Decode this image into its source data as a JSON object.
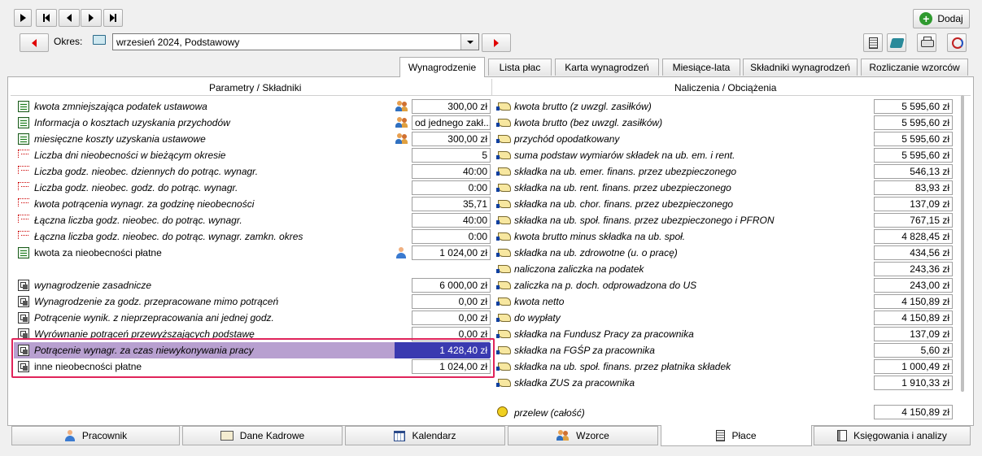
{
  "nav": {
    "period_label": "Okres:",
    "period_value": "wrzesień 2024, Podstawowy"
  },
  "toolbar": {
    "add_label": "Dodaj"
  },
  "tabs": [
    {
      "label": "Wynagrodzenie",
      "active": true
    },
    {
      "label": "Lista płac",
      "active": false
    },
    {
      "label": "Karta wynagrodzeń",
      "active": false
    },
    {
      "label": "Miesiące-lata",
      "active": false
    },
    {
      "label": "Składniki wynagrodzeń",
      "active": false
    },
    {
      "label": "Rozliczanie wzorców",
      "active": false
    }
  ],
  "left": {
    "header": "Parametry / Składniki",
    "rows": [
      {
        "label": "kwota zmniejszająca podatek ustawowa",
        "value": "300,00 zł",
        "icon": "doc-icon",
        "extra": "people-icon"
      },
      {
        "label": "Informacja o kosztach uzyskania przychodów",
        "value": "od jednego zakł...",
        "icon": "doc-icon",
        "extra": "people-icon"
      },
      {
        "label": "miesięczne koszty uzyskania ustawowe",
        "value": "300,00 zł",
        "icon": "doc-icon",
        "extra": "people-icon"
      },
      {
        "label": "Liczba dni nieobecności w bieżącym okresie",
        "value": "5",
        "icon": "dots-icon"
      },
      {
        "label": "Liczba godz. nieobec. dziennych do potrąc. wynagr.",
        "value": "40:00",
        "icon": "dots-icon"
      },
      {
        "label": "Liczba godz. nieobec. godz. do potrąc. wynagr.",
        "value": "0:00",
        "icon": "dots-icon"
      },
      {
        "label": "kwota potrącenia wynagr. za godzinę nieobecności",
        "value": "35,71",
        "icon": "dots-icon"
      },
      {
        "label": "Łączna liczba godz. nieobec. do potrąc. wynagr.",
        "value": "40:00",
        "icon": "dots-icon"
      },
      {
        "label": "Łączna liczba godz. nieobec. do potrąc. wynagr. zamkn. okres",
        "value": "0:00",
        "icon": "dots-icon"
      },
      {
        "label": "kwota za nieobecności płatne",
        "value": "1 024,00 zł",
        "icon": "doc-icon",
        "extra": "person-icon",
        "normal": true
      },
      {
        "label": "wynagrodzenie zasadnicze",
        "value": "6 000,00 zł",
        "icon": "calc-icon"
      },
      {
        "label": "Wynagrodzenie za godz. przepracowane mimo potrąceń",
        "value": "0,00 zł",
        "icon": "calc-icon"
      },
      {
        "label": "Potrącenie wynik. z nieprzepracowania ani jednej godz.",
        "value": "0,00 zł",
        "icon": "calc-icon"
      },
      {
        "label": "Wyrównanie potrąceń przewyższających podstawę",
        "value": "0,00 zł",
        "icon": "calc-icon"
      },
      {
        "label": "Potrącenie wynagr. za czas niewykonywania pracy",
        "value": "1 428,40 zł",
        "icon": "calc-icon",
        "selected": true
      },
      {
        "label": "inne nieobecności płatne",
        "value": "1 024,00 zł",
        "icon": "calc-icon",
        "normal": true
      }
    ]
  },
  "right": {
    "header": "Naliczenia / Obciążenia",
    "rows": [
      {
        "label": "kwota brutto (z uwzgl. zasiłków)",
        "value": "5 595,60 zł"
      },
      {
        "label": "kwota brutto (bez uwzgl. zasiłków)",
        "value": "5 595,60 zł"
      },
      {
        "label": "przychód opodatkowany",
        "value": "5 595,60 zł"
      },
      {
        "label": "suma podstaw wymiarów składek na ub. em. i rent.",
        "value": "5 595,60 zł"
      },
      {
        "label": "składka na ub. emer. finans. przez ubezpieczonego",
        "value": "546,13 zł"
      },
      {
        "label": "składka na ub. rent. finans. przez ubezpieczonego",
        "value": "83,93 zł"
      },
      {
        "label": "składka na ub. chor. finans. przez ubezpieczonego",
        "value": "137,09 zł"
      },
      {
        "label": "składka na ub. społ. finans. przez ubezpieczonego i PFRON",
        "value": "767,15 zł"
      },
      {
        "label": "kwota brutto minus składka na ub. społ.",
        "value": "4 828,45 zł"
      },
      {
        "label": "składka na ub. zdrowotne (u. o pracę)",
        "value": "434,56 zł"
      },
      {
        "label": "naliczona zaliczka na podatek",
        "value": "243,36 zł"
      },
      {
        "label": "zaliczka na p. doch. odprowadzona do US",
        "value": "243,00 zł"
      },
      {
        "label": "kwota netto",
        "value": "4 150,89 zł"
      },
      {
        "label": "do wypłaty",
        "value": "4 150,89 zł"
      },
      {
        "label": "składka na Fundusz Pracy za pracownika",
        "value": "137,09 zł"
      },
      {
        "label": "składka na FGŚP za pracownika",
        "value": "5,60 zł"
      },
      {
        "label": "składka na ub. społ. finans. przez płatnika składek",
        "value": "1 000,49 zł"
      },
      {
        "label": "składka ZUS za pracownika",
        "value": "1 910,33 zł"
      }
    ],
    "transfer": {
      "label": "przelew (całość)",
      "value": "4 150,89 zł"
    }
  },
  "bottom_tabs": [
    {
      "label": "Pracownik",
      "icon": "person-icon"
    },
    {
      "label": "Dane Kadrowe",
      "icon": "id-card-icon"
    },
    {
      "label": "Kalendarz",
      "icon": "calendar-icon"
    },
    {
      "label": "Wzorce",
      "icon": "people-icon"
    },
    {
      "label": "Płace",
      "icon": "calculator-icon",
      "active": true
    },
    {
      "label": "Księgowania i analizy",
      "icon": "book-icon"
    }
  ]
}
